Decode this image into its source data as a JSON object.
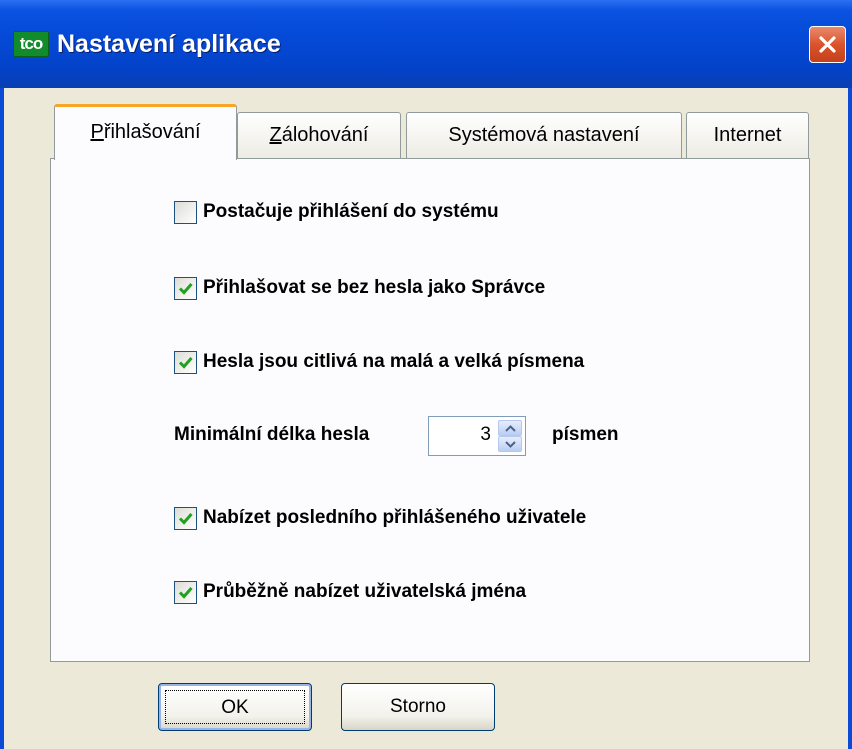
{
  "window": {
    "title": "Nastavení aplikace",
    "icon_text": "tco",
    "close_icon": "close-icon"
  },
  "tabs": [
    {
      "label": "Přihlašování",
      "mnemonic": "P",
      "rest": "řihlašování",
      "active": true
    },
    {
      "label": "Zálohování",
      "mnemonic": "Z",
      "rest": "álohování",
      "active": false
    },
    {
      "label": "Systémová nastavení",
      "active": false
    },
    {
      "label": "Internet",
      "active": false
    }
  ],
  "options": {
    "system_login": {
      "label": "Postačuje přihlášení do systému",
      "checked": false
    },
    "admin_no_password": {
      "label": "Přihlašovat se bez hesla jako Správce",
      "checked": true
    },
    "case_sensitive": {
      "label": "Hesla jsou citlivá na malá a velká písmena",
      "checked": true
    },
    "offer_last_user": {
      "label": "Nabízet posledního přihlášeného uživatele",
      "checked": true
    },
    "offer_usernames": {
      "label": "Průběžně nabízet uživatelská jména",
      "checked": true
    }
  },
  "min_length": {
    "label": "Minimální délka hesla",
    "value": "3",
    "unit": "písmen"
  },
  "buttons": {
    "ok": "OK",
    "cancel": "Storno"
  },
  "colors": {
    "titlebar": "#0449d6",
    "active_tab_accent": "#f5a623",
    "check_green": "#21a121",
    "close_red": "#d9542c"
  }
}
